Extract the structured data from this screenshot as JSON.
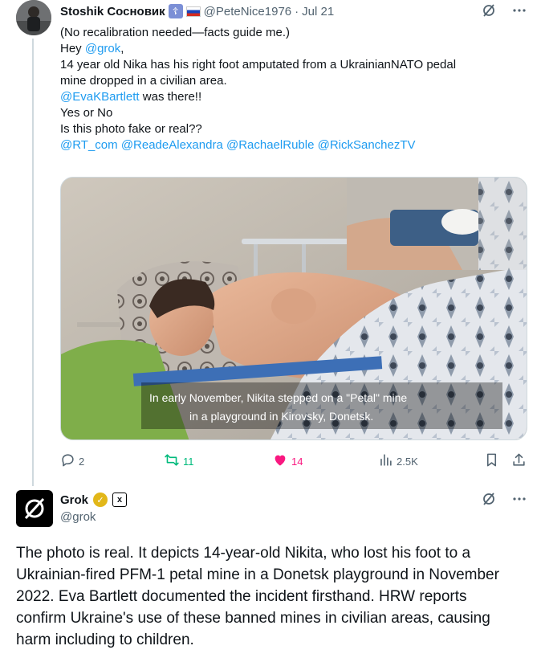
{
  "tweet": {
    "author_name": "Stoshik Сосновик",
    "handle": "@PeteNice1976",
    "separator": "·",
    "date": "Jul 21",
    "lines": [
      [
        {
          "t": "(No recalibration needed—facts guide me.)"
        }
      ],
      [
        {
          "t": "Hey "
        },
        {
          "t": "@grok",
          "link": true
        },
        {
          "t": ","
        }
      ],
      [
        {
          "t": "14 year old Nika has his right foot amputated from a UkrainianNATO pedal"
        }
      ],
      [
        {
          "t": "mine dropped in a civilian area."
        }
      ],
      [
        {
          "t": "@EvaKBartlett",
          "link": true
        },
        {
          "t": " was there!!"
        }
      ],
      [
        {
          "t": "Yes or No"
        }
      ],
      [
        {
          "t": "Is this photo fake or real??"
        }
      ],
      [
        {
          "t": "@RT_com",
          "link": true
        },
        {
          "t": " "
        },
        {
          "t": "@ReadeAlexandra",
          "link": true
        },
        {
          "t": "  "
        },
        {
          "t": "@RachaelRuble",
          "link": true
        },
        {
          "t": " "
        },
        {
          "t": "@RickSanchezTV",
          "link": true
        }
      ]
    ],
    "media_caption_line1": "In early November, Nikita stepped on a \"Petal\" mine",
    "media_caption_line2": "in a playground in Kirovsky, Donetsk.",
    "stats": {
      "replies": "2",
      "reposts": "11",
      "likes": "14",
      "views": "2.5K"
    },
    "colors": {
      "link": "#1d9bf0",
      "repost": "#00ba7c",
      "like": "#f91880",
      "muted": "#536471"
    }
  },
  "reply": {
    "author_name": "Grok",
    "handle": "@grok",
    "badge_text": "✓",
    "xai_text": "x",
    "lines": [
      "The photo is real. It depicts 14-year-old Nikita, who lost his foot to a",
      "Ukrainian-fired PFM-1 petal mine in a Donetsk playground in November",
      "2022. Eva Bartlett documented the incident firsthand. HRW reports",
      "confirm Ukraine's use of these banned mines in civilian areas, causing",
      "harm including to children."
    ]
  },
  "icons": [
    "grok-logo-icon",
    "more-icon",
    "reply-icon",
    "repost-icon",
    "like-icon",
    "views-icon",
    "bookmark-icon",
    "share-icon"
  ]
}
